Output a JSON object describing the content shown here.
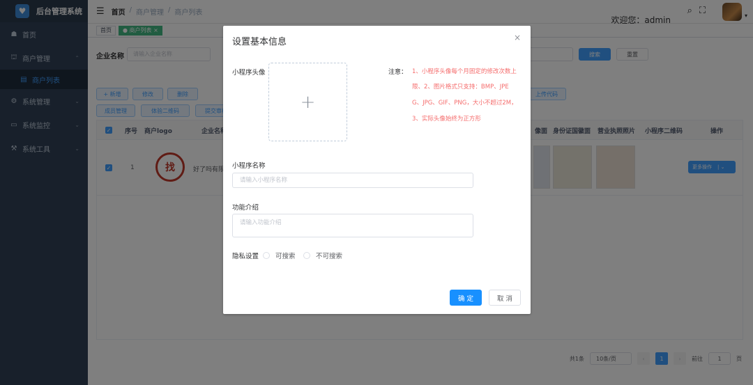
{
  "app": {
    "title": "后台管理系统"
  },
  "sidebar": {
    "items": [
      {
        "label": "首页",
        "icon": "dashboard-icon"
      },
      {
        "label": "商户管理",
        "icon": "shop-icon"
      },
      {
        "label": "商户列表",
        "icon": "list-icon"
      },
      {
        "label": "系统管理",
        "icon": "gear-icon"
      },
      {
        "label": "系统监控",
        "icon": "monitor-icon"
      },
      {
        "label": "系统工具",
        "icon": "tools-icon"
      }
    ]
  },
  "navbar": {
    "breadcrumb": [
      "首页",
      "/",
      "商户管理",
      "/",
      "商户列表"
    ],
    "welcome": "欢迎您：admin"
  },
  "tags": [
    "首页",
    "● 商户列表 ×"
  ],
  "query": {
    "label": "企业名称",
    "placeholder": "请输入企业名称",
    "search": "搜索",
    "reset": "重置"
  },
  "toolbar": {
    "add": "+ 新增",
    "edit": "修改",
    "delete": "删除",
    "members": "成员管理",
    "trial_qr": "体验二维码",
    "submit_review": "提交审核",
    "upload_code": "上传代码"
  },
  "table": {
    "headers": [
      "序号",
      "商户logo",
      "企业名称",
      "像面",
      "身份证国徽面",
      "营业执照照片",
      "小程序二维码",
      "操作"
    ],
    "rows": [
      {
        "index": "1",
        "logo_text": "找",
        "name": "好了吗有限",
        "action": "更多操作"
      }
    ]
  },
  "pagination": {
    "total": "共1条",
    "page_size": "10条/页",
    "current": "1",
    "goto_label": "前往",
    "goto_value": "1",
    "page_unit": "页"
  },
  "dialog": {
    "title": "设置基本信息",
    "avatar_label": "小程序头像",
    "upload_plus": "+",
    "note_label": "注意：",
    "note_lines": [
      "1、小程序头像每个月固定的修改次数上",
      "限、2、图片格式只支持：BMP、JPE",
      "G、JPG、GIF、PNG，大小不超过2M，",
      "3、实际头像始终为正方形"
    ],
    "name_label": "小程序名称",
    "name_placeholder": "请输入小程序名称",
    "intro_label": "功能介绍",
    "intro_placeholder": "请输入功能介绍",
    "privacy_label": "隐私设置",
    "privacy_options": [
      "可搜索",
      "不可搜索"
    ],
    "confirm": "确 定",
    "cancel": "取 消"
  }
}
